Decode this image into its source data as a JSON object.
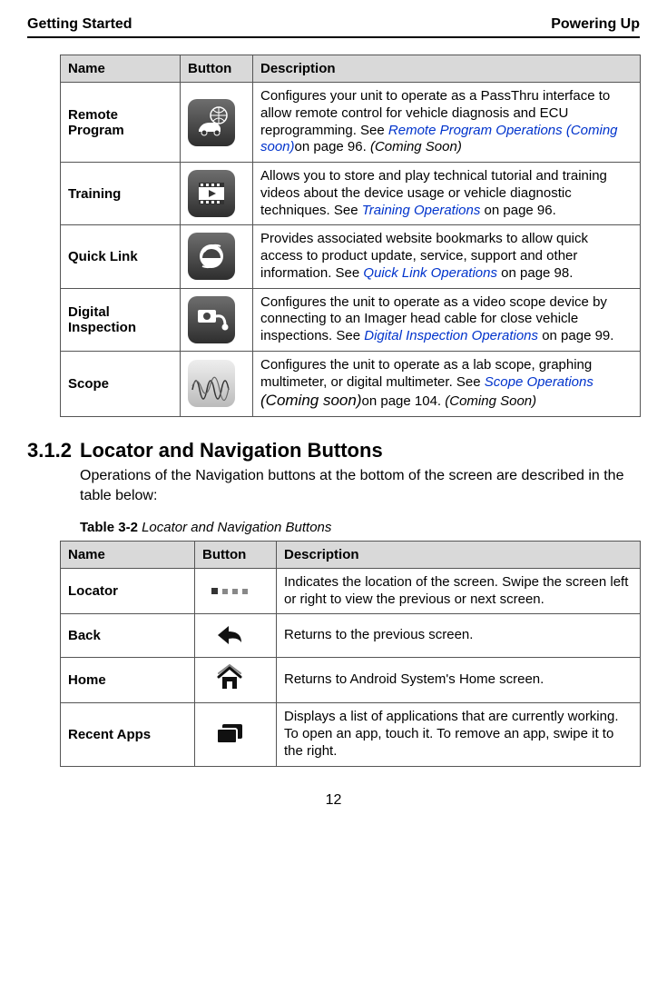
{
  "header": {
    "left": "Getting Started",
    "right": "Powering Up"
  },
  "table1": {
    "headers": {
      "name": "Name",
      "button": "Button",
      "desc": "Description"
    },
    "rows": [
      {
        "name": "Remote Program",
        "icon": "car-globe-icon",
        "desc_pre": "Configures your unit to operate as a PassThru interface to allow remote control for vehicle diagnosis and ECU reprogramming. See ",
        "xref": "Remote Program Operations ",
        "xref_ital": "(Coming soon)",
        "desc_post": "on page 96. ",
        "tail_ital": "(Coming Soon)"
      },
      {
        "name": "Training",
        "icon": "film-icon",
        "desc_pre": "Allows you to store and play technical tutorial and training videos about the device usage or vehicle diagnostic techniques. See ",
        "xref": "Training Operations",
        "desc_post": " on page 96."
      },
      {
        "name": "Quick Link",
        "icon": "ie-icon",
        "desc_pre": "Provides associated website bookmarks to allow quick access to product update, service, support and other information. See ",
        "xref": "Quick Link Operations",
        "desc_post": " on page 98."
      },
      {
        "name": "Digital Inspection",
        "icon": "scope-cam-icon",
        "desc_pre": "Configures the unit to operate as a video scope device by connecting to an Imager head cable for close vehicle inspections. See ",
        "xref": "Digital Inspection Operations",
        "desc_post": " on page 99."
      },
      {
        "name": "Scope",
        "icon": "waveform-icon",
        "desc_pre": "Configures the unit to operate as a lab scope, graphing multimeter, or digital multimeter. See ",
        "xref": "Scope Operations ",
        "xref_big_ital": "(Coming soon)",
        "desc_post": "on page 104. ",
        "tail_ital": "(Coming Soon)"
      }
    ]
  },
  "section": {
    "number": "3.1.2",
    "title": "Locator and Navigation Buttons",
    "body": "Operations of the Navigation buttons at the bottom of the screen are described in the table below:",
    "caption_bold": "Table 3-2",
    "caption_ital": " Locator and Navigation Buttons"
  },
  "table2": {
    "headers": {
      "name": "Name",
      "button": "Button",
      "desc": "Description"
    },
    "rows": [
      {
        "name": "Locator",
        "icon": "locator-icon",
        "desc": "Indicates the location of the screen. Swipe the screen left or right to view the previous or next screen."
      },
      {
        "name": "Back",
        "icon": "back-icon",
        "desc": "Returns to the previous screen."
      },
      {
        "name": "Home",
        "icon": "home-icon",
        "desc": "Returns to Android System's Home screen."
      },
      {
        "name": "Recent Apps",
        "icon": "recent-icon",
        "desc": "Displays a list of applications that are currently working. To open an app, touch it. To remove an app, swipe it to the right."
      }
    ]
  },
  "page_number": "12"
}
